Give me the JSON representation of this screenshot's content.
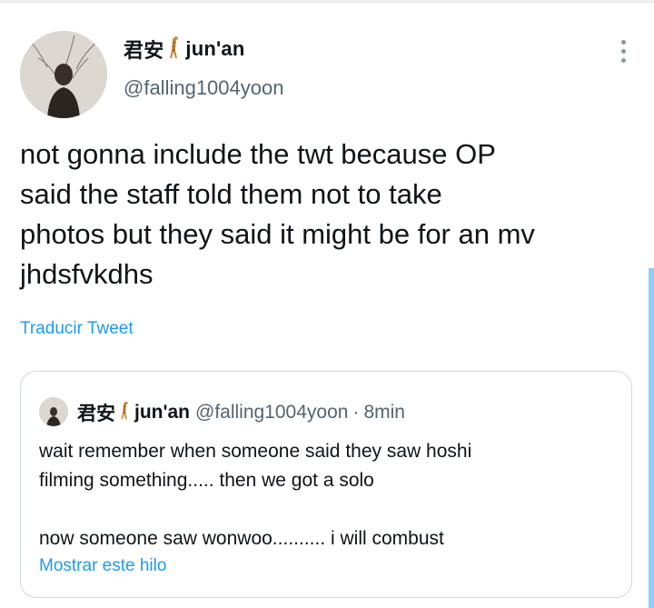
{
  "tweet": {
    "display_name_prefix": "君安",
    "display_name_suffix": "jun'an",
    "handle": "@falling1004yoon",
    "text": "not gonna include the twt because OP\nsaid the staff told them not to take\nphotos but they said it might be for an mv\njhdsfvkdhs",
    "translate_label": "Traducir Tweet"
  },
  "quoted": {
    "display_name_prefix": "君安",
    "display_name_suffix": "jun'an",
    "handle": "@falling1004yoon",
    "separator": "·",
    "time": "8min",
    "text": "wait remember when someone said they saw hoshi\nfilming something..... then we got a solo\n\nnow someone saw wonwoo.......... i will combust",
    "show_thread_label": "Mostrar este hilo"
  },
  "icons": {
    "more": "more-vertical-icon",
    "emoji": "giraffe-emoji-icon"
  },
  "colors": {
    "link": "#1d9bf0",
    "secondary_text": "#536471",
    "border": "#cfd9de"
  }
}
